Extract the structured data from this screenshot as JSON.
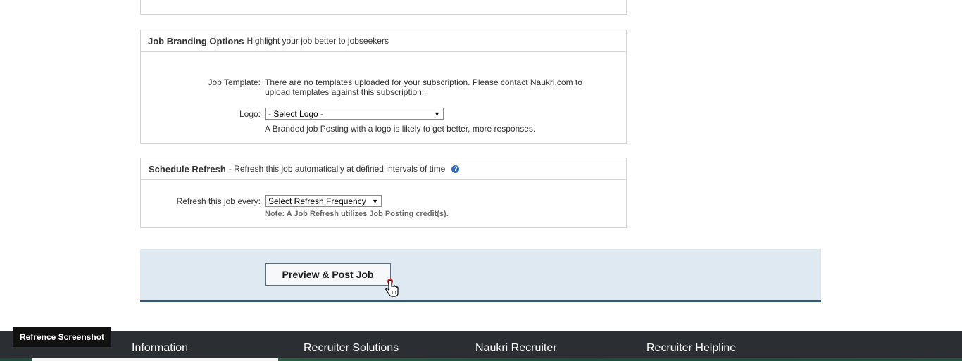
{
  "branding": {
    "title": "Job Branding Options",
    "subtitle": "Highlight your job better to jobseekers",
    "template_label": "Job Template:",
    "template_text_line1": "There are no templates uploaded for your subscription. Please contact Naukri.com to",
    "template_text_line2": "upload templates against this subscription.",
    "logo_label": "Logo:",
    "logo_select_value": "- Select Logo -",
    "logo_hint": "A Branded job Posting with a logo is likely to get better, more responses."
  },
  "refresh": {
    "title": "Schedule Refresh",
    "subtitle": "- Refresh this job automatically at defined intervals of time",
    "help_icon_text": "?",
    "label": "Refresh this job every:",
    "select_value": "Select Refresh Frequency",
    "note": "Note: A Job Refresh utilizes Job Posting credit(s)."
  },
  "actions": {
    "post_button_label": "Preview & Post Job"
  },
  "footer": {
    "columns": [
      "Information",
      "Recruiter Solutions",
      "Naukri Recruiter",
      "Recruiter Helpline"
    ]
  },
  "badge": {
    "label": "Refrence Screenshot"
  },
  "icons": {
    "dropdown": "triangle-down-icon",
    "help": "question-circle-icon",
    "cursor": "hand-pointer-icon"
  },
  "colors": {
    "action_band_bg": "#dfe9f2",
    "action_band_border": "#2e5b8c",
    "footer_bg": "#2b2f33",
    "help_icon": "#2d6cc0"
  }
}
